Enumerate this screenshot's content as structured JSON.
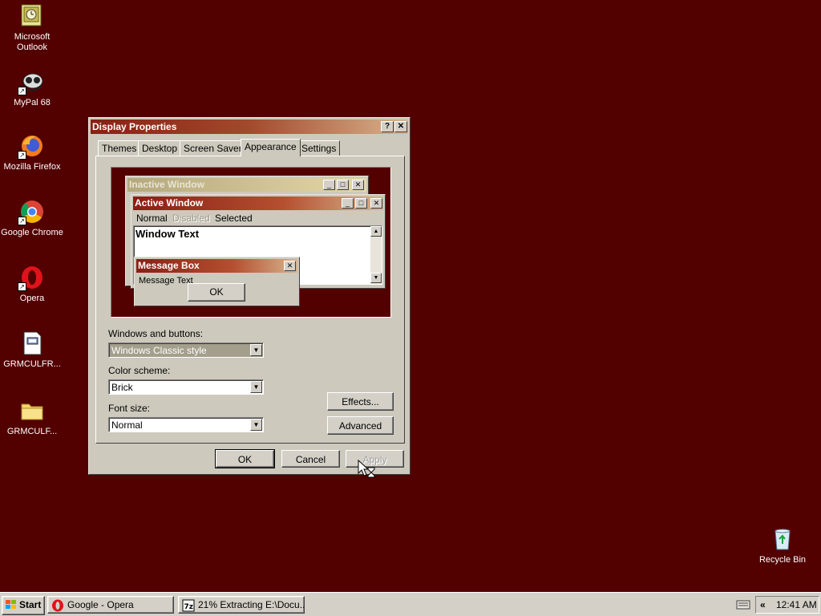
{
  "desktop": {
    "icons": [
      {
        "label": "Microsoft\nOutlook",
        "icon": "outlook-icon"
      },
      {
        "label": "MyPal 68",
        "icon": "mypal-icon"
      },
      {
        "label": "Mozilla Firefox",
        "icon": "firefox-icon"
      },
      {
        "label": "Google Chrome",
        "icon": "chrome-icon"
      },
      {
        "label": "Opera",
        "icon": "opera-icon"
      },
      {
        "label": "GRMCULFR...",
        "icon": "document-icon"
      },
      {
        "label": "GRMCULF...",
        "icon": "folder-icon"
      },
      {
        "label": "Recycle Bin",
        "icon": "recycle-bin-icon"
      }
    ],
    "background_color": "#520000"
  },
  "dialog": {
    "title": "Display Properties",
    "help_button": "?",
    "close_button": "✕",
    "tabs": [
      "Themes",
      "Desktop",
      "Screen Saver",
      "Appearance",
      "Settings"
    ],
    "active_tab": "Appearance",
    "preview": {
      "inactive_title": "Inactive Window",
      "active_title": "Active Window",
      "menu": {
        "normal": "Normal",
        "disabled": "Disabled",
        "selected": "Selected"
      },
      "window_text": "Window Text",
      "message_box_title": "Message Box",
      "message_text": "Message Text",
      "ok": "OK"
    },
    "windows_and_buttons_label": "Windows and buttons:",
    "windows_and_buttons_value": "Windows Classic style",
    "color_scheme_label": "Color scheme:",
    "color_scheme_value": "Brick",
    "font_size_label": "Font size:",
    "font_size_value": "Normal",
    "effects_button": "Effects...",
    "advanced_button": "Advanced",
    "ok_button": "OK",
    "cancel_button": "Cancel",
    "apply_button": "Apply"
  },
  "taskbar": {
    "start_label": "Start",
    "tasks": [
      {
        "label": "Google - Opera",
        "icon": "opera-icon"
      },
      {
        "label": "21% Extracting E:\\Docu...",
        "icon": "7zip-icon"
      }
    ],
    "tray_chevron": "«",
    "clock": "12:41 AM"
  }
}
